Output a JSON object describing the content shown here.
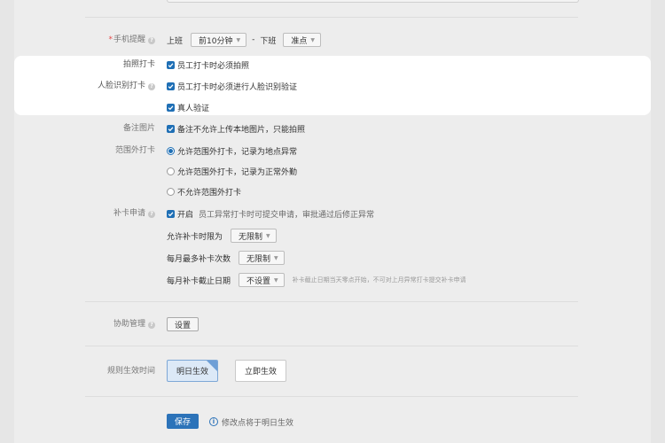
{
  "form": {
    "phone_reminder": {
      "label": "手机提醒",
      "required_mark": "*",
      "clock_in_text": "上班",
      "clock_in_select": "前10分钟",
      "separator": "-",
      "clock_out_text": "下班",
      "clock_out_select": "准点"
    },
    "photo_punch": {
      "label": "拍照打卡",
      "option": "员工打卡时必须拍照"
    },
    "face_punch": {
      "label": "人脸识别打卡",
      "option": "员工打卡时必须进行人脸识别验证",
      "sub_option": "真人验证"
    },
    "remark_image": {
      "label": "备注图片",
      "option": "备注不允许上传本地图片，只能拍照"
    },
    "out_of_range": {
      "label": "范围外打卡",
      "options": [
        "允许范围外打卡，记录为地点异常",
        "允许范围外打卡，记录为正常外勤",
        "不允许范围外打卡"
      ],
      "selected_index": 0
    },
    "makeup": {
      "label": "补卡申请",
      "enable_text": "开启",
      "description": "员工异常打卡时可提交申请，审批通过后修正异常",
      "time_limit_label": "允许补卡时限为",
      "time_limit_value": "无限制",
      "max_times_label": "每月最多补卡次数",
      "max_times_value": "无限制",
      "deadline_label": "每月补卡截止日期",
      "deadline_value": "不设置",
      "deadline_hint": "补卡截止日期当天零点开始，不可对上月异常打卡提交补卡申请"
    },
    "assist": {
      "label": "协助管理",
      "button": "设置"
    },
    "effective": {
      "label": "规则生效时间",
      "option_tomorrow": "明日生效",
      "option_now": "立即生效",
      "selected": "option_tomorrow"
    },
    "footer": {
      "save_label": "保存",
      "note": "修改点将于明日生效"
    }
  },
  "colors": {
    "accent": "#2c73b9",
    "required": "#e64a4a",
    "highlight_bg": "#ffffff",
    "page_bg": "#ededed"
  },
  "icons": {
    "help": "question-circle-icon",
    "check": "checkmark-icon",
    "info": "info-circle-icon",
    "dropdown": "caret-down-icon"
  }
}
